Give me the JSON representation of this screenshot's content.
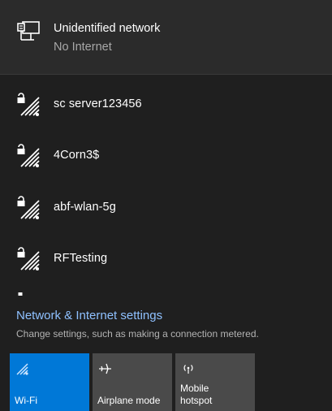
{
  "connected_network": {
    "name": "Unidentified network",
    "status": "No Internet",
    "icon": "ethernet-icon"
  },
  "networks": [
    {
      "name": "sc server123456",
      "icon": "secured-wifi-icon"
    },
    {
      "name": "4Corn3$",
      "icon": "secured-wifi-icon"
    },
    {
      "name": "abf-wlan-5g",
      "icon": "secured-wifi-icon"
    },
    {
      "name": "RFTesting",
      "icon": "secured-wifi-icon"
    }
  ],
  "settings": {
    "link_label": "Network & Internet settings",
    "description": "Change settings, such as making a connection metered."
  },
  "quick_actions": [
    {
      "label": "Wi-Fi",
      "icon": "wifi-icon",
      "active": true
    },
    {
      "label": "Airplane mode",
      "icon": "airplane-icon",
      "active": false
    },
    {
      "label_line1": "Mobile",
      "label_line2": "hotspot",
      "icon": "mobile-hotspot-icon",
      "active": false
    }
  ],
  "colors": {
    "accent": "#0078d7",
    "link": "#8fc1ff",
    "background": "#1f1f1f",
    "tile": "#4a4a4a"
  }
}
